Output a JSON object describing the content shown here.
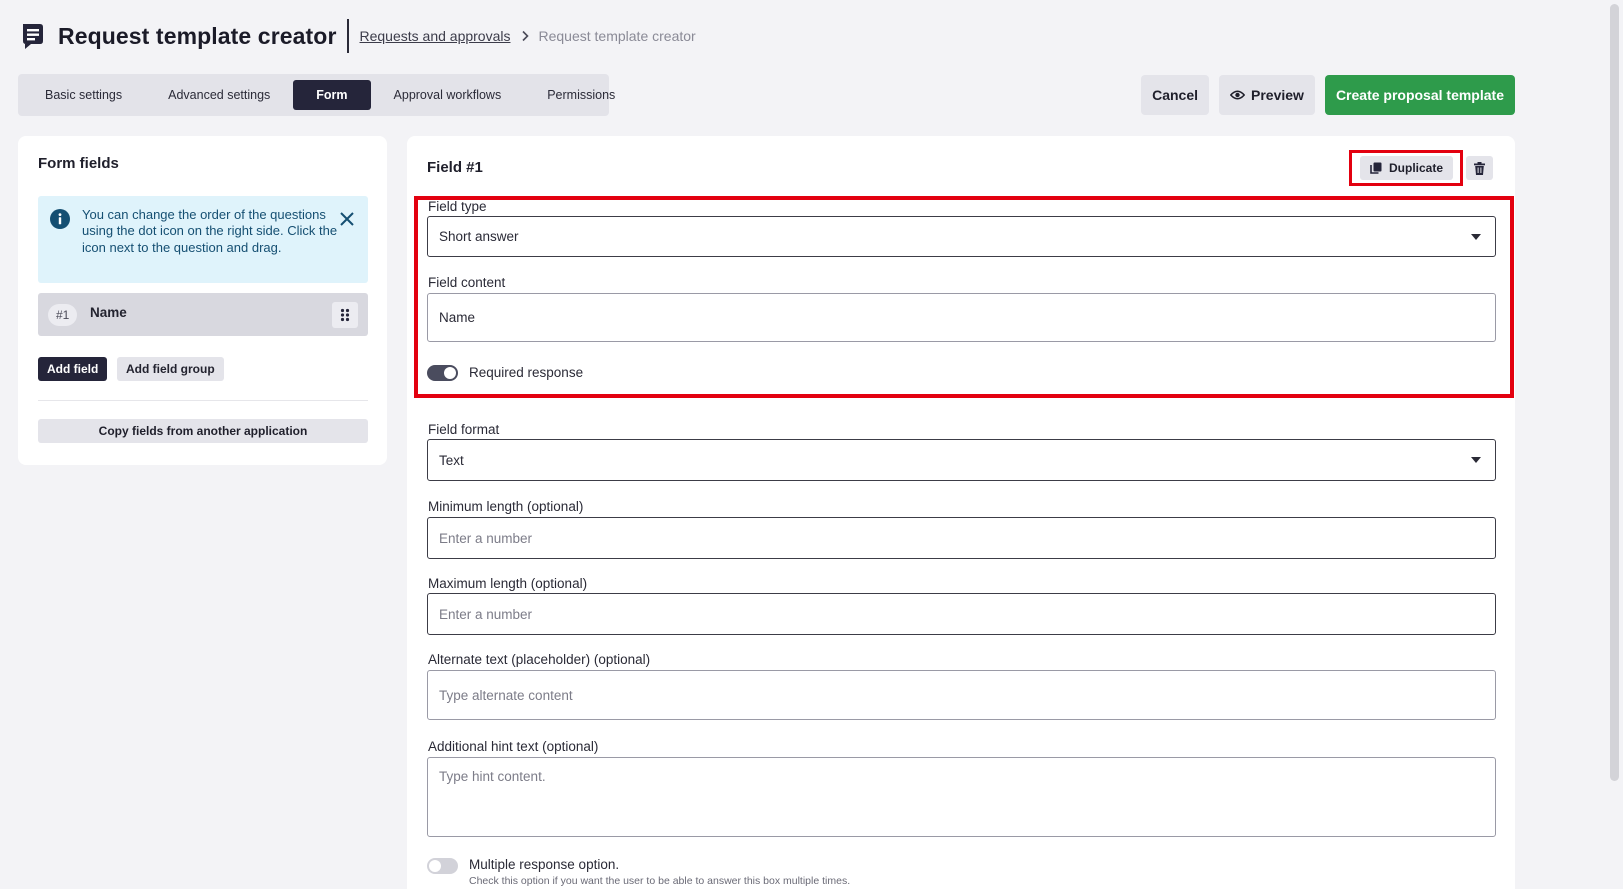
{
  "header": {
    "title": "Request template creator",
    "breadcrumb_link": "Requests and approvals",
    "breadcrumb_separator": ">",
    "breadcrumb_current": "Request template creator"
  },
  "tabs": [
    {
      "label": "Basic settings",
      "active": false
    },
    {
      "label": "Advanced settings",
      "active": false
    },
    {
      "label": "Form",
      "active": true
    },
    {
      "label": "Approval workflows",
      "active": false
    },
    {
      "label": "Permissions",
      "active": false
    }
  ],
  "actions": {
    "cancel_label": "Cancel",
    "preview_label": "Preview",
    "create_label": "Create proposal template"
  },
  "form_fields_panel": {
    "heading": "Form fields",
    "info_text": "You can change the order of the questions using the dot icon on the right side. Click the icon next to the question and drag.",
    "fields": [
      {
        "number": "#1",
        "name": "Name"
      }
    ],
    "add_field_label": "Add field",
    "add_field_group_label": "Add field group",
    "copy_fields_label": "Copy fields from another application"
  },
  "field_editor": {
    "title": "Field #1",
    "duplicate_label": "Duplicate",
    "field_type": {
      "label": "Field type",
      "value": "Short answer"
    },
    "field_content": {
      "label": "Field content",
      "value": "Name"
    },
    "required_response": {
      "label": "Required response",
      "on": true
    },
    "field_format": {
      "label": "Field format",
      "value": "Text"
    },
    "min_length": {
      "label": "Minimum length (optional)",
      "placeholder": "Enter a number"
    },
    "max_length": {
      "label": "Maximum length (optional)",
      "placeholder": "Enter a number"
    },
    "alt_text": {
      "label": "Alternate text (placeholder) (optional)",
      "placeholder": "Type alternate content"
    },
    "hint_text": {
      "label": "Additional hint text (optional)",
      "placeholder": "Type hint content."
    },
    "multiple_response": {
      "label": "Multiple response option.",
      "description": "Check this option if you want the user to be able to answer this box multiple times.",
      "on": false
    }
  },
  "colors": {
    "accent_dark": "#25253a",
    "create_green": "#2e9b4b",
    "info_bg": "#dff3fb",
    "info_text": "#154f72",
    "highlight_red": "#e3000f"
  }
}
